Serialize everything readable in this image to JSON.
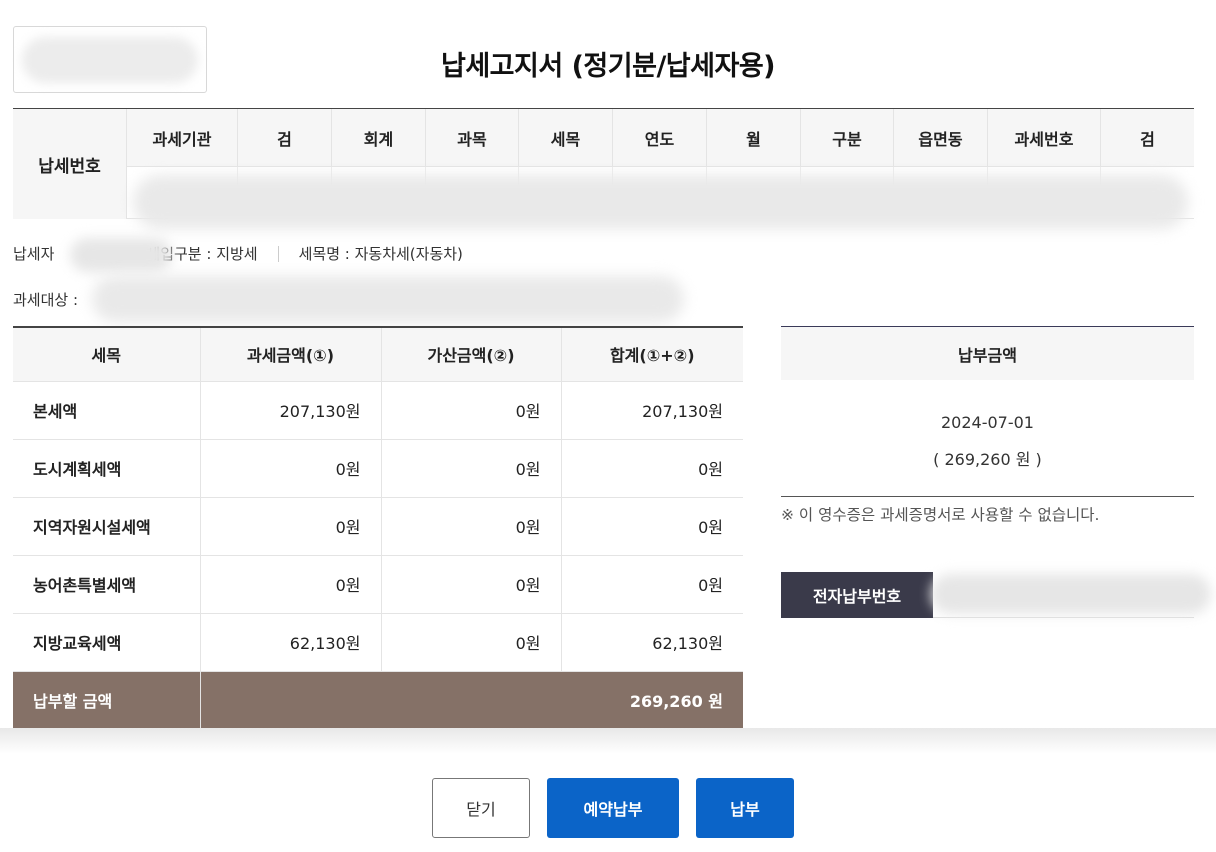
{
  "title": "납세고지서 (정기분/납세자용)",
  "tax_number": {
    "label": "납세번호",
    "columns": [
      "과세기관",
      "검",
      "회계",
      "과목",
      "세목",
      "연도",
      "월",
      "구분",
      "읍면동",
      "과세번호",
      "검"
    ]
  },
  "info": {
    "taxpayer_label": "납세자",
    "revenue_type": "세입구분 : 지방세",
    "tax_item_name": "세목명 : 자동차세(자동차)",
    "tax_target_label": "과세대상 :"
  },
  "detail_table": {
    "headers": [
      "세목",
      "과세금액(①)",
      "가산금액(②)",
      "합계(①+②)"
    ],
    "rows": [
      {
        "name": "본세액",
        "base": "207,130원",
        "add": "0원",
        "sum": "207,130원"
      },
      {
        "name": "도시계획세액",
        "base": "0원",
        "add": "0원",
        "sum": "0원"
      },
      {
        "name": "지역자원시설세액",
        "base": "0원",
        "add": "0원",
        "sum": "0원"
      },
      {
        "name": "농어촌특별세액",
        "base": "0원",
        "add": "0원",
        "sum": "0원"
      },
      {
        "name": "지방교육세액",
        "base": "62,130원",
        "add": "0원",
        "sum": "62,130원"
      }
    ],
    "total_label": "납부할 금액",
    "total_value": "269,260 원"
  },
  "payment": {
    "header": "납부금액",
    "date": "2024-07-01",
    "amount": "( 269,260 원 )",
    "notice": "※ 이 영수증은 과세증명서로 사용할 수 없습니다.",
    "epay_label": "전자납부번호"
  },
  "buttons": {
    "close": "닫기",
    "reserve": "예약납부",
    "pay": "납부"
  }
}
